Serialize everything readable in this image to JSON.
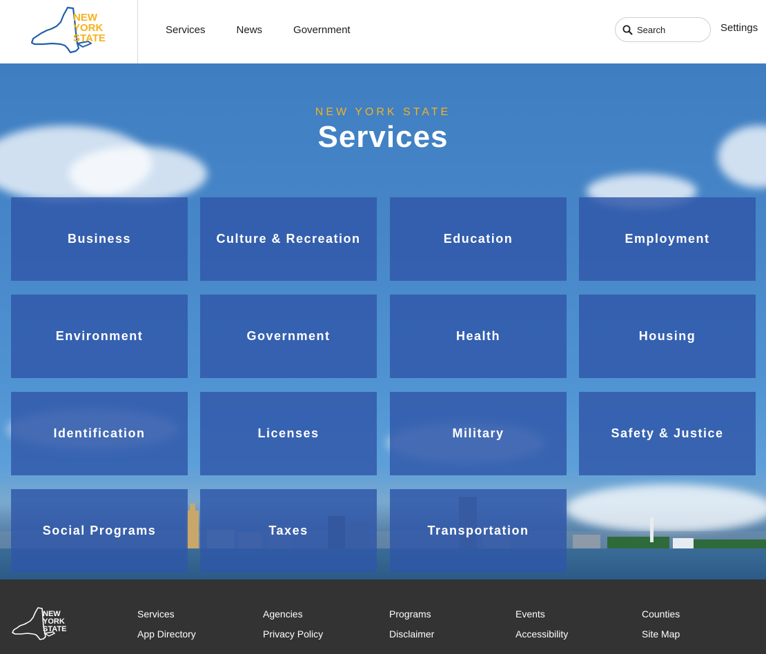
{
  "header": {
    "logo_text": [
      "NEW",
      "YORK",
      "STATE"
    ],
    "nav": [
      "Services",
      "News",
      "Government"
    ],
    "search_label": "Search",
    "settings_label": "Settings"
  },
  "hero": {
    "kicker": "NEW YORK STATE",
    "title": "Services"
  },
  "tiles": [
    "Business",
    "Culture & Recreation",
    "Education",
    "Employment",
    "Environment",
    "Government",
    "Health",
    "Housing",
    "Identification",
    "Licenses",
    "Military",
    "Safety & Justice",
    "Social Programs",
    "Taxes",
    "Transportation"
  ],
  "footer": {
    "logo_text": [
      "NEW",
      "YORK",
      "STATE"
    ],
    "columns": [
      [
        "Services",
        "App Directory"
      ],
      [
        "Agencies",
        "Privacy Policy"
      ],
      [
        "Programs",
        "Disclaimer"
      ],
      [
        "Events",
        "Accessibility"
      ],
      [
        "Counties",
        "Site Map"
      ]
    ]
  },
  "colors": {
    "brand_blue": "#1f5fa8",
    "brand_gold": "#f4b21f",
    "tile": "#3057a8",
    "footer": "#333333"
  }
}
